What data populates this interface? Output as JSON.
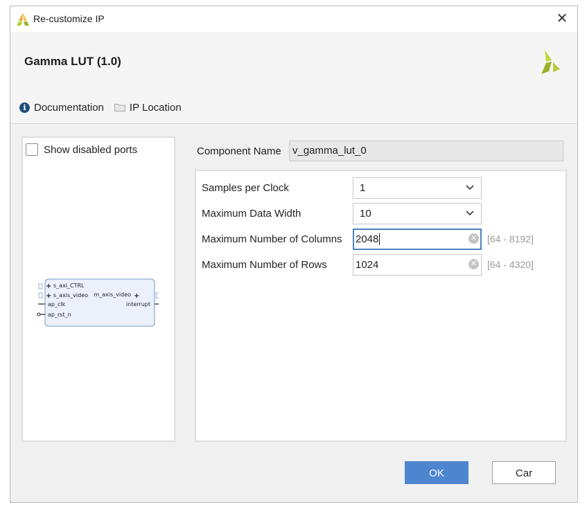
{
  "window": {
    "title": "Re-customize IP",
    "close_symbol": "✕"
  },
  "header": {
    "ip_name": "Gamma LUT (1.0)",
    "links": [
      {
        "label": "Documentation",
        "icon": "info-icon"
      },
      {
        "label": "IP Location",
        "icon": "folder-icon"
      }
    ]
  },
  "left_panel": {
    "show_disabled_ports": {
      "label": "Show disabled ports",
      "checked": false
    },
    "block": {
      "left_ports": [
        "s_axi_CTRL",
        "s_axis_video",
        "ap_clk",
        "ap_rst_n"
      ],
      "right_ports": [
        "m_axis_video",
        "interrupt"
      ]
    }
  },
  "component": {
    "label": "Component Name",
    "value": "v_gamma_lut_0"
  },
  "params": [
    {
      "label": "Samples per Clock",
      "type": "select",
      "value": "1"
    },
    {
      "label": "Maximum Data Width",
      "type": "select",
      "value": "10"
    },
    {
      "label": "Maximum Number of Columns",
      "type": "text",
      "value": "2048",
      "range": "[64 - 8192]",
      "focused": true
    },
    {
      "label": "Maximum Number of Rows",
      "type": "text",
      "value": "1024",
      "range": "[64 - 4320]",
      "focused": false
    }
  ],
  "buttons": {
    "ok": "OK",
    "cancel": "Car"
  },
  "colors": {
    "ok_button": "#4d86cf",
    "focus_border": "#4a7fc1",
    "logo_light": "#c3d73b",
    "logo_dark": "#9bb32a"
  }
}
